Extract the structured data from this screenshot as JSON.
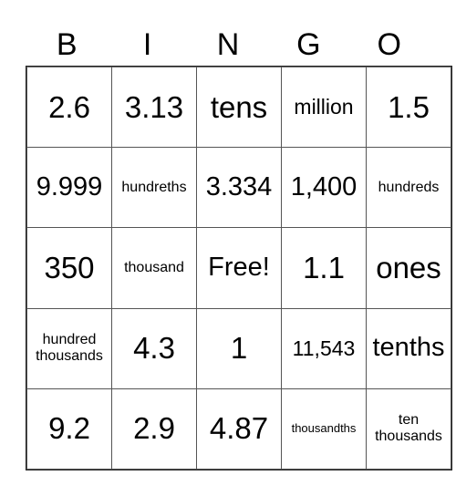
{
  "card": {
    "header": [
      "B",
      "I",
      "N",
      "G",
      "O"
    ],
    "rows": [
      [
        "2.6",
        "3.13",
        "tens",
        "million",
        "1.5"
      ],
      [
        "9.999",
        "hundreths",
        "3.334",
        "1,400",
        "hundreds"
      ],
      [
        "350",
        "thousand",
        "Free!",
        "1.1",
        "ones"
      ],
      [
        "hundred thousands",
        "4.3",
        "1",
        "11,543",
        "tenths"
      ],
      [
        "9.2",
        "2.9",
        "4.87",
        "thousandths",
        "ten thousands"
      ]
    ]
  }
}
